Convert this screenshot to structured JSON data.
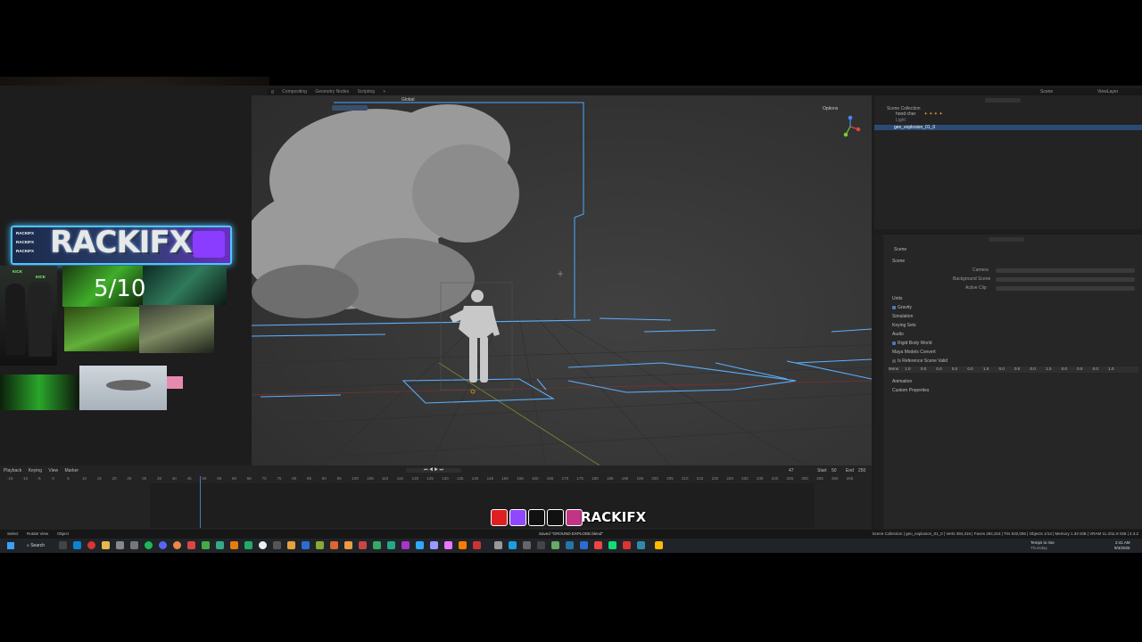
{
  "topbar": {
    "workspace_tabs": [
      "g",
      "Compositing",
      "Geometry Nodes",
      "Scripting",
      "+"
    ],
    "scene_label": "Scene",
    "view_layer_label": "ViewLayer"
  },
  "viewport": {
    "orientation": "Global",
    "options_label": "Options"
  },
  "outliner": {
    "title": "Scene Collection",
    "items": [
      {
        "label": "hood char"
      },
      {
        "label": "Light"
      },
      {
        "label": "geo_explosion_01_0",
        "selected": true
      }
    ]
  },
  "properties": {
    "header": "Scene",
    "section_scene": "Scene",
    "camera_label": "Camera",
    "background_scene_label": "Background Scene",
    "active_clip_label": "Active Clip",
    "sections": [
      "Units",
      "Gravity",
      "Simulation",
      "Keying Sets",
      "Audio",
      "Rigid Body World",
      "Maya Models Convert",
      "Is Reference Scene Valid"
    ],
    "numbers_row_label": "Items",
    "numbers": [
      "1.0",
      "0.0",
      "0.0",
      "0.0",
      "0.0",
      "1.0",
      "0.0",
      "0.0",
      "0.0",
      "1.0",
      "0.0",
      "0.0",
      "0.0",
      "1.0"
    ],
    "sections_after": [
      "Animation",
      "Custom Properties"
    ]
  },
  "timeline": {
    "menu": [
      "Playback",
      "Keying",
      "View",
      "Marker"
    ],
    "current_frame": "47",
    "start_label": "Start",
    "start": "50",
    "end_label": "End",
    "end": "250",
    "ticks": [
      "-15",
      "-10",
      "-5",
      "0",
      "5",
      "10",
      "15",
      "20",
      "25",
      "30",
      "35",
      "40",
      "45",
      "50",
      "55",
      "60",
      "65",
      "70",
      "75",
      "80",
      "85",
      "90",
      "95",
      "100",
      "105",
      "110",
      "115",
      "120",
      "125",
      "130",
      "135",
      "140",
      "145",
      "150",
      "155",
      "160",
      "165",
      "170",
      "175",
      "180",
      "185",
      "190",
      "195",
      "200",
      "205",
      "210",
      "215",
      "220",
      "225",
      "230",
      "235",
      "240",
      "245",
      "250",
      "255",
      "260",
      "265"
    ]
  },
  "statusbar": {
    "left": [
      "Select",
      "Rotate View",
      "Object"
    ],
    "message": "Saved \"GROUND EXPLODE.blend\"",
    "right": "Scene Collection | geo_explosion_01_0 | Verts 394,316 | Faces 294,316 | Tris 532,006 | Objects 1/14 | Memory 1.33 GiB | VRAM 11.4/11.8 GiB | 4.3.2"
  },
  "overlay": {
    "channel_name": "RACKIFX",
    "banner_small": [
      "RACKIFX",
      "RACKIFX",
      "RACKIFX"
    ],
    "counter": "5/10",
    "kick_labels": [
      "KICK",
      "KICK"
    ],
    "social_handle": "RACKIFX",
    "social_icons": [
      "youtube-icon",
      "twitch-icon",
      "x-icon",
      "tiktok-icon",
      "instagram-icon"
    ]
  },
  "taskbar": {
    "search_label": "Search",
    "weather": "Temps to rise",
    "weather_sub": "Thursday",
    "time": "2:41 AM",
    "date": "9/4/2025"
  }
}
